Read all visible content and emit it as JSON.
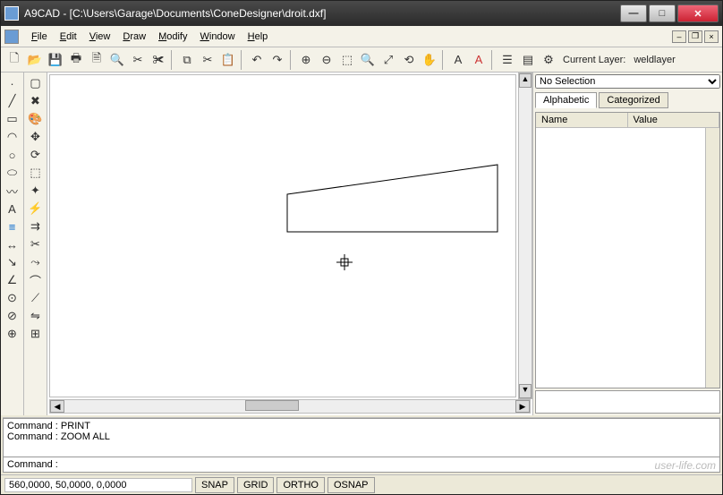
{
  "window": {
    "title": "A9CAD - [C:\\Users\\Garage\\Documents\\ConeDesigner\\droit.dxf]"
  },
  "menus": [
    "File",
    "Edit",
    "View",
    "Draw",
    "Modify",
    "Window",
    "Help"
  ],
  "toolbar": {
    "layer_label": "Current Layer:",
    "layer_value": "weldlayer"
  },
  "props": {
    "selection": "No Selection",
    "tab_alpha": "Alphabetic",
    "tab_cat": "Categorized",
    "col_name": "Name",
    "col_value": "Value"
  },
  "cmd": {
    "log1": "Command : PRINT",
    "log2": "Command : ZOOM ALL",
    "prompt": "Command :"
  },
  "status": {
    "coords": "560,0000, 50,0000, 0,0000",
    "snap": "SNAP",
    "grid": "GRID",
    "ortho": "ORTHO",
    "osnap": "OSNAP"
  },
  "watermark": "user-life.com"
}
